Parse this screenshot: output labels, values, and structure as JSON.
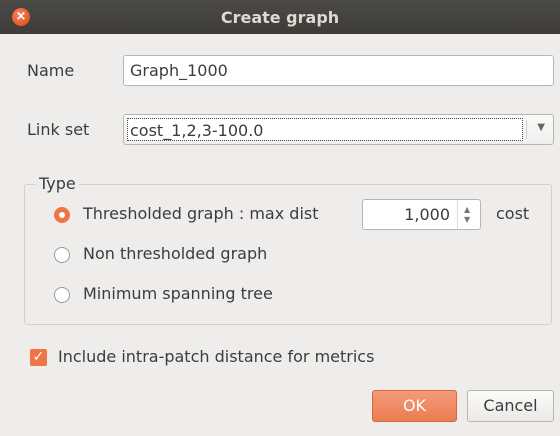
{
  "window": {
    "title": "Create graph",
    "close_glyph": "×"
  },
  "name": {
    "label": "Name",
    "value": "Graph_1000"
  },
  "linkset": {
    "label": "Link set",
    "value": "cost_1,2,3-100.0"
  },
  "type_group": {
    "title": "Type",
    "options": [
      {
        "label": "Thresholded graph : max dist",
        "checked": true
      },
      {
        "label": "Non thresholded graph",
        "checked": false
      },
      {
        "label": "Minimum spanning tree",
        "checked": false
      }
    ],
    "max_dist_value": "1,000",
    "max_dist_unit": "cost"
  },
  "intra_patch": {
    "label": "Include intra-patch distance for metrics",
    "checked": true,
    "check_glyph": "✓"
  },
  "buttons": {
    "ok": "OK",
    "cancel": "Cancel"
  },
  "colors": {
    "accent": "#ef7546",
    "titlebar": "#403f3b"
  }
}
